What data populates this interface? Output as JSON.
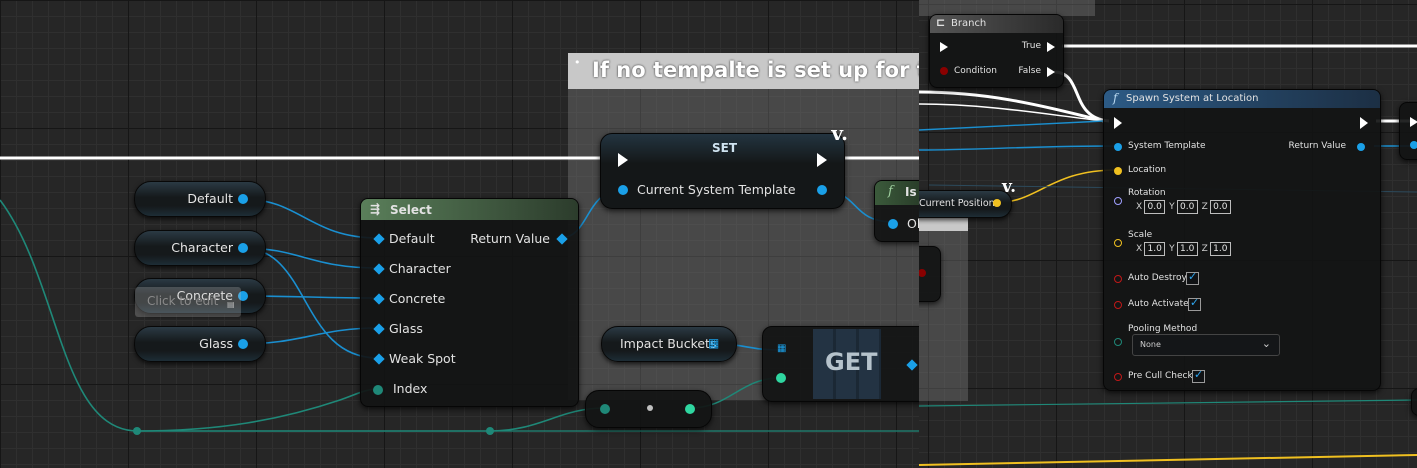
{
  "comment": {
    "title": "If no tempalte is set up for this"
  },
  "variables": {
    "default": "Default",
    "character": "Character",
    "concrete": "Concrete",
    "glass": "Glass",
    "impact_buckets": "Impact Buckets",
    "current_position": "Current Position"
  },
  "tooltip": {
    "text": "Click to edit"
  },
  "select_node": {
    "title": "Select",
    "inputs": [
      "Default",
      "Character",
      "Concrete",
      "Glass",
      "Weak Spot",
      "Index"
    ],
    "output": "Return Value"
  },
  "set_node": {
    "title": "SET",
    "pin": "Current System Template",
    "badge": "v."
  },
  "get_node": {
    "title": "GET"
  },
  "is_node": {
    "title": "Is",
    "pin": "Ob"
  },
  "branch_node": {
    "title": "Branch",
    "true_label": "True",
    "false_label": "False",
    "condition_label": "Condition"
  },
  "spawn_node": {
    "title": "Spawn System at Location",
    "system_template": "System Template",
    "location": "Location",
    "rotation": "Rotation",
    "rotation_values": {
      "x": "0.0",
      "y": "0.0",
      "z": "0.0"
    },
    "scale": "Scale",
    "scale_values": {
      "x": "1.0",
      "y": "1.0",
      "z": "1.0"
    },
    "auto_destroy": "Auto Destroy",
    "auto_activate": "Auto Activate",
    "pooling_method": "Pooling Method",
    "pooling_value": "None",
    "pre_cull_check": "Pre Cull Check",
    "return_value": "Return Value",
    "axis_x": "X",
    "axis_y": "Y",
    "axis_z": "Z"
  },
  "current_position_badge": "v.",
  "colors": {
    "exec_wire": "#ffffff",
    "object_pin": "#1aa0e8",
    "int_pin": "#2fd6a0",
    "vector_pin": "#f0c020",
    "bool_pin": "#8a0000",
    "select_header": "#4a6a4a",
    "function_header": "#23456a"
  }
}
